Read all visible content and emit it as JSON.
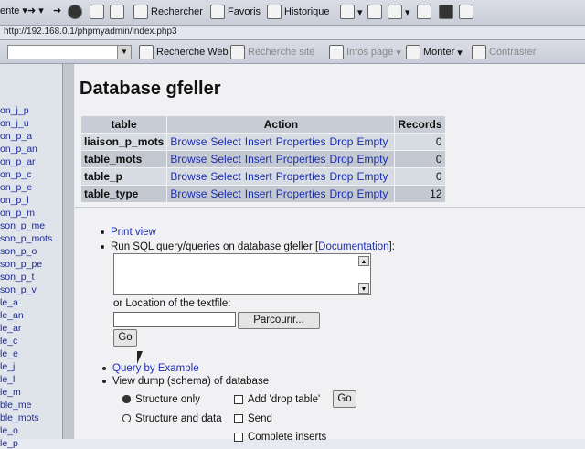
{
  "toolbar": {
    "fragment": "ente",
    "search": "Rechercher",
    "favorites": "Favoris",
    "history": "Historique"
  },
  "address": "http://192.168.0.1/phpmyadmin/index.php3",
  "toolbar2": {
    "web_search": "Recherche Web",
    "site_search": "Recherche site",
    "page_info": "Infos page",
    "up": "Monter",
    "contrast": "Contraster"
  },
  "sidebar": {
    "items": [
      "on_j_p",
      "on_j_u",
      "on_p_a",
      "on_p_an",
      "on_p_ar",
      "on_p_c",
      "on_p_e",
      "on_p_l",
      "on_p_m",
      "son_p_me",
      "son_p_mots",
      "son_p_o",
      "son_p_pe",
      "son_p_t",
      "son_p_v",
      "le_a",
      "le_an",
      "le_ar",
      "le_c",
      "le_e",
      "le_j",
      "le_l",
      "le_m",
      "ble_me",
      "ble_mots",
      "le_o",
      "le_p"
    ]
  },
  "main": {
    "title": "Database gfeller",
    "headers": {
      "table": "table",
      "action": "Action",
      "records": "Records"
    },
    "actions": [
      "Browse",
      "Select",
      "Insert",
      "Properties",
      "Drop",
      "Empty"
    ],
    "rows": [
      {
        "name": "liaison_p_mots",
        "records": "0"
      },
      {
        "name": "table_mots",
        "records": "0"
      },
      {
        "name": "table_p",
        "records": "0"
      },
      {
        "name": "table_type",
        "records": "12"
      }
    ],
    "print_view": "Print view",
    "run_sql": "Run SQL query/queries on database gfeller [",
    "documentation": "Documentation",
    "run_sql_end": "]:",
    "location_label": "or Location of the textfile:",
    "browse_button": "Parcourir...",
    "go": "Go",
    "query_by_example": "Query by Example",
    "view_dump": "View dump (schema) of database",
    "structure_only": "Structure only",
    "structure_data": "Structure and data",
    "add_drop": "Add 'drop table'",
    "send": "Send",
    "complete_inserts": "Complete inserts"
  }
}
